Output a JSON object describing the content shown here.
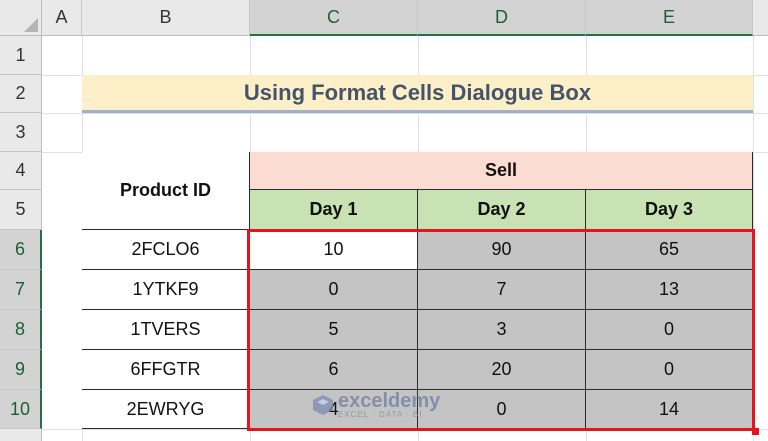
{
  "columns": [
    "A",
    "B",
    "C",
    "D",
    "E"
  ],
  "rows": [
    "1",
    "2",
    "3",
    "4",
    "5",
    "6",
    "7",
    "8",
    "9",
    "10"
  ],
  "title": "Using Format Cells Dialogue Box",
  "table": {
    "product_header": "Product ID",
    "group_header": "Sell",
    "day_headers": [
      "Day 1",
      "Day 2",
      "Day 3"
    ],
    "rows": [
      {
        "id": "2FCLO6",
        "values": [
          "10",
          "90",
          "65"
        ]
      },
      {
        "id": "1YTKF9",
        "values": [
          "0",
          "7",
          "13"
        ]
      },
      {
        "id": "1TVERS",
        "values": [
          "5",
          "3",
          "0"
        ]
      },
      {
        "id": "6FFGTR",
        "values": [
          "6",
          "20",
          "0"
        ]
      },
      {
        "id": "2EWRYG",
        "values": [
          "4",
          "0",
          "14"
        ]
      }
    ]
  },
  "watermark": {
    "brand": "exceldemy",
    "tagline": "EXCEL · DATA · BI"
  },
  "colors": {
    "selection_border": "#e8141c",
    "selected_fill": "#c4c4c4",
    "header_accent": "#217346"
  }
}
